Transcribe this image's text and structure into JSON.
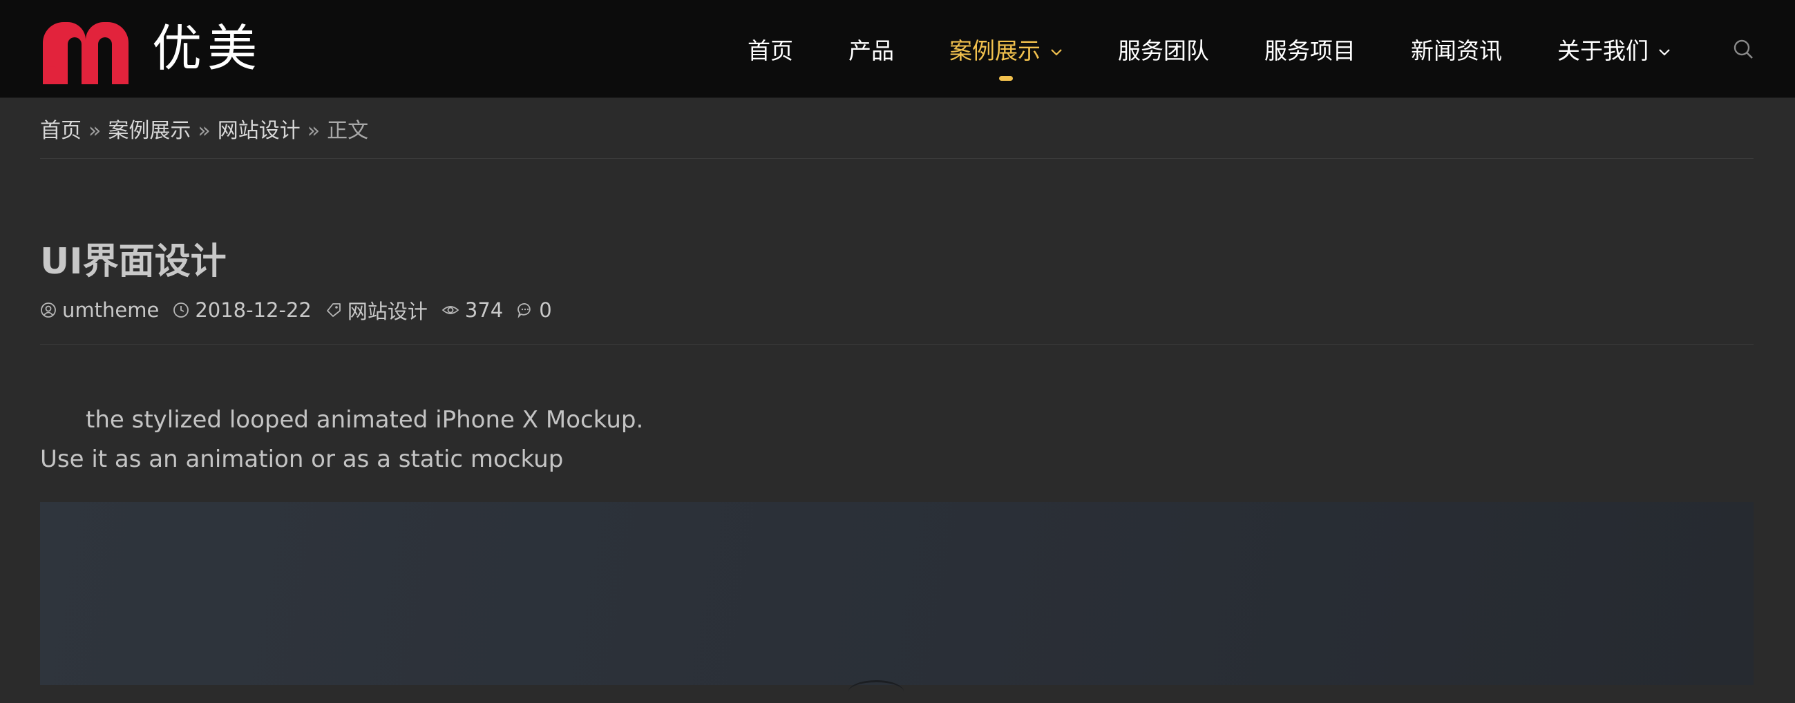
{
  "logo": {
    "text": "优美",
    "brand_color": "#e2233c"
  },
  "nav": {
    "items": [
      {
        "label": "首页"
      },
      {
        "label": "产品"
      },
      {
        "label": "案例展示",
        "active": true,
        "has_dropdown": true
      },
      {
        "label": "服务团队"
      },
      {
        "label": "服务项目"
      },
      {
        "label": "新闻资讯"
      },
      {
        "label": "关于我们",
        "has_dropdown": true
      }
    ],
    "active_color": "#f2c14e",
    "search_icon": "search-icon"
  },
  "breadcrumb": {
    "home": "首页",
    "sep": "»",
    "level1": "案例展示",
    "level2": "网站设计",
    "current": "正文"
  },
  "article": {
    "title": "UI界面设计",
    "author": "umtheme",
    "date": "2018-12-22",
    "category": "网站设计",
    "views": "374",
    "comments": "0",
    "paragraph1": "the stylized looped animated iPhone X Mockup.",
    "paragraph2": "Use it as an animation or as a static mockup"
  }
}
